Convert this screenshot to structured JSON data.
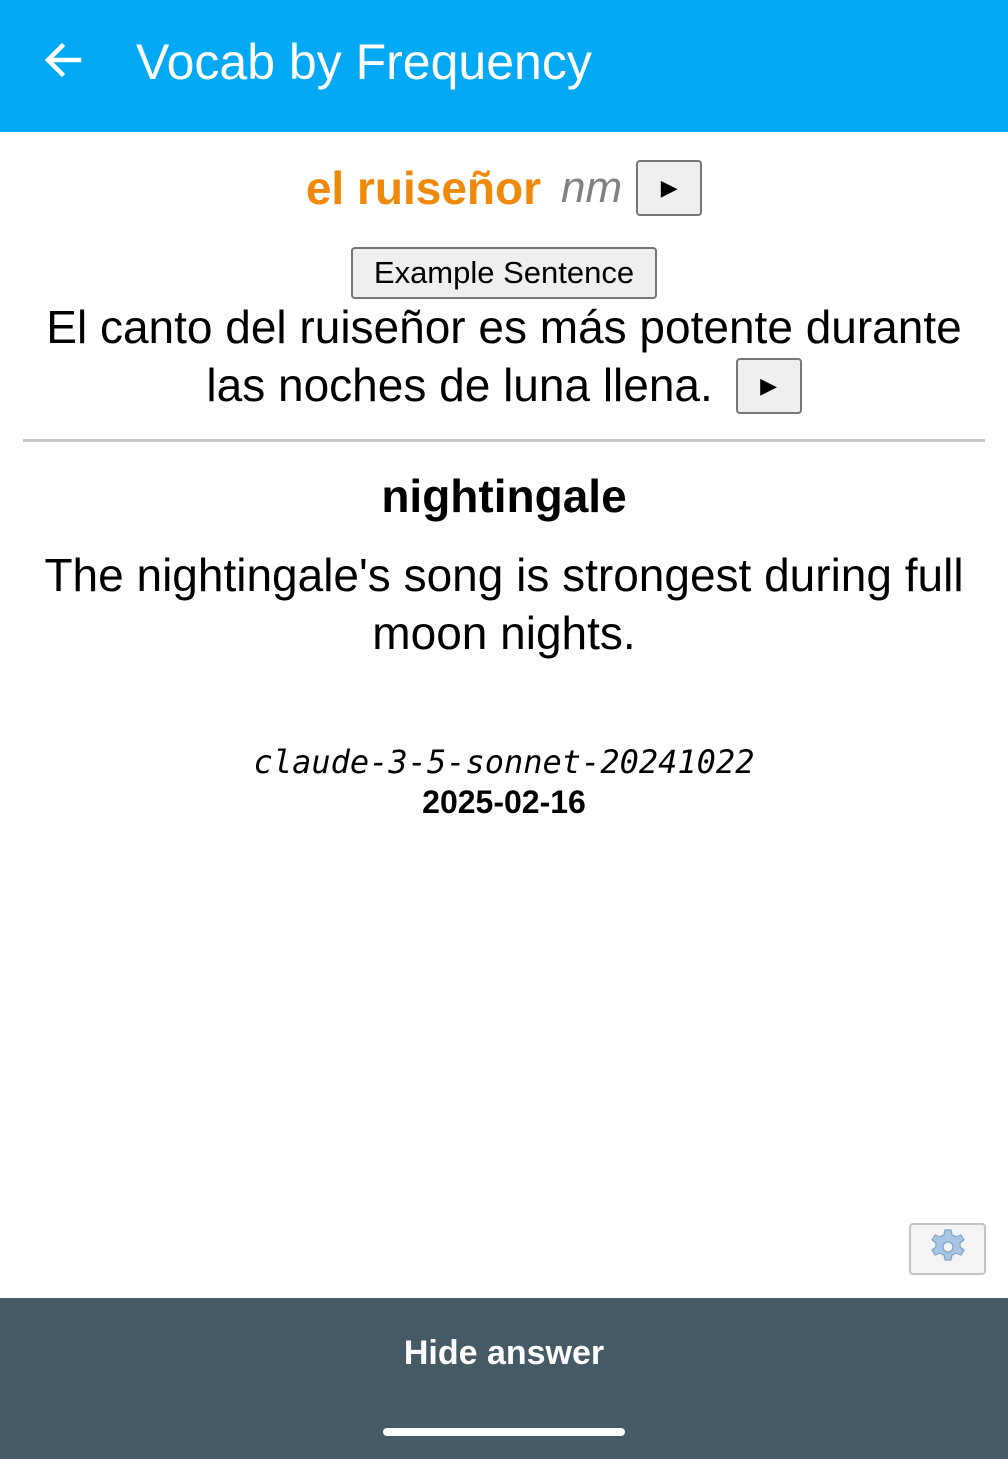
{
  "appbar": {
    "title": "Vocab by Frequency",
    "back_icon": "arrow-left-icon",
    "background_color": "#03a9f4"
  },
  "card": {
    "word": "el ruiseñor",
    "word_color": "#f0890a",
    "part_of_speech": "nm",
    "play_icon": "▶",
    "example_button_label": "Example Sentence",
    "example_sentence": "El canto del ruiseñor es más potente durante las noches de luna llena.",
    "translation": "nightingale",
    "translated_sentence": "The nightingale's song is strongest during full moon nights.",
    "model": "claude-3-5-sonnet-20241022",
    "date": "2025-02-16",
    "settings_icon": "gear-icon"
  },
  "bottom_bar": {
    "answer_button_label": "Hide answer",
    "background_color": "#465a66"
  }
}
